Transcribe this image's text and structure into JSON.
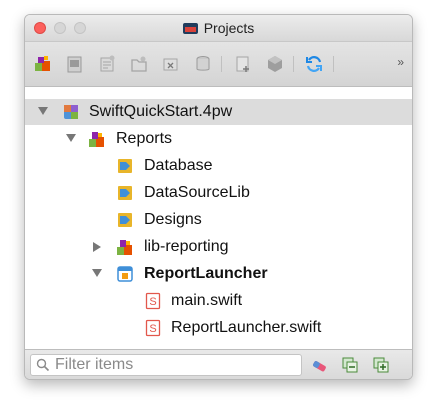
{
  "window": {
    "title": "Projects"
  },
  "toolbar": {
    "icons": [
      "new-project-icon",
      "new-file-icon",
      "new-report-icon",
      "new-folder-icon",
      "add-datasource-icon",
      "database-icon",
      "add-item-icon",
      "deploy-icon",
      "refresh-icon"
    ],
    "overflow": "»"
  },
  "tree": {
    "rows": [
      {
        "label": "SwiftQuickStart.4pw",
        "icon": "workspace-icon",
        "expanded": true,
        "selected": true
      },
      {
        "label": "Reports",
        "icon": "project-icon",
        "expanded": true
      },
      {
        "label": "Database",
        "icon": "folder-icon"
      },
      {
        "label": "DataSourceLib",
        "icon": "folder-icon"
      },
      {
        "label": "Designs",
        "icon": "folder-icon"
      },
      {
        "label": "lib-reporting",
        "icon": "project-icon",
        "expanded": false
      },
      {
        "label": "ReportLauncher",
        "icon": "app-target-icon",
        "expanded": true,
        "bold": true
      },
      {
        "label": "main.swift",
        "icon": "swift-file-icon"
      },
      {
        "label": "ReportLauncher.swift",
        "icon": "swift-file-icon"
      }
    ]
  },
  "filter": {
    "placeholder": "Filter items",
    "value": ""
  },
  "colors": {
    "folder": "#e8b52a",
    "swift": "#e2574c",
    "selection": "#dcdcdc"
  }
}
